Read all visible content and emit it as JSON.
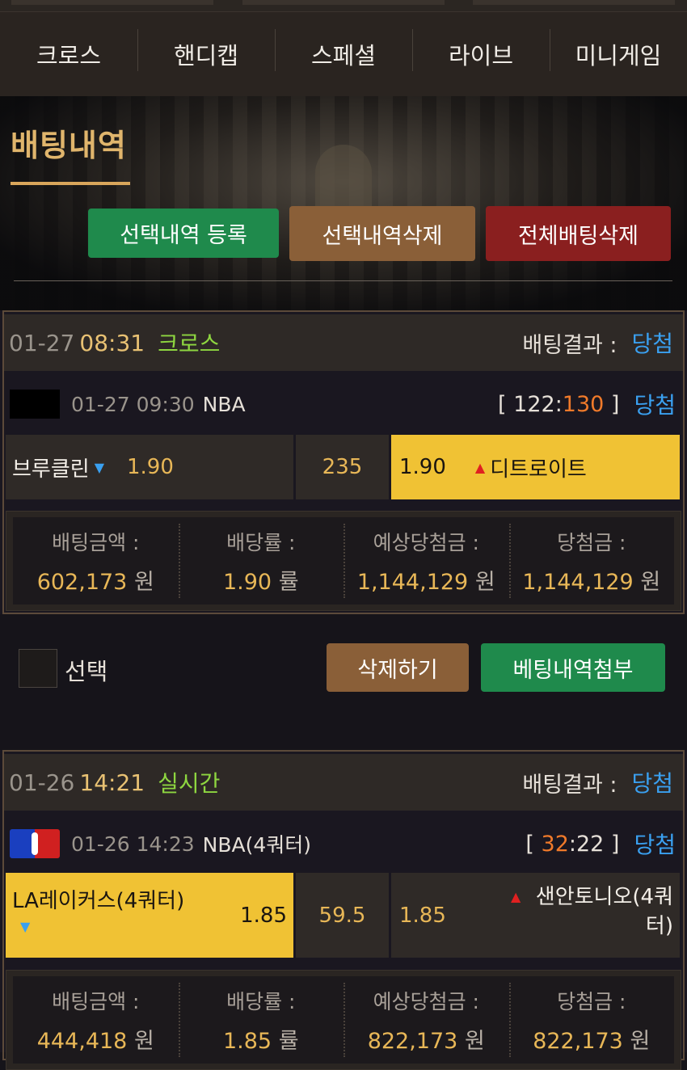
{
  "nav": {
    "items": [
      "크로스",
      "핸디캡",
      "스페셜",
      "라이브",
      "미니게임"
    ]
  },
  "hero": {
    "title": "배팅내역",
    "buttons": {
      "register": "선택내역 등록",
      "delete_selected": "선택내역삭제",
      "delete_all": "전체배팅삭제"
    }
  },
  "bets": [
    {
      "date": "01-27",
      "time": "08:31",
      "type": "크로스",
      "result_label": "배팅결과 :",
      "result": "당첨",
      "match": {
        "date": "01-27 09:30",
        "league": "NBA",
        "score_left": "122",
        "score_right": "130",
        "result": "당첨",
        "home": "브루클린",
        "home_odd": "1.90",
        "line": "235",
        "away_odd": "1.90",
        "away": "디트로이트",
        "selected": "away"
      },
      "summary": {
        "bet_amount_label": "배팅금액 :",
        "bet_amount": "602,173",
        "odds_label": "배당률 :",
        "odds": "1.90",
        "expected_label": "예상당첨금 :",
        "expected": "1,144,129",
        "win_label": "당첨금 :",
        "win": "1,144,129",
        "won_unit": "원",
        "rate_unit": "률"
      }
    },
    {
      "date": "01-26",
      "time": "14:21",
      "type": "실시간",
      "result_label": "배팅결과 :",
      "result": "당첨",
      "match": {
        "date": "01-26 14:23",
        "league": "NBA(4쿼터)",
        "score_left": "32",
        "score_right": "22",
        "result": "당첨",
        "home": "LA레이커스(4쿼터)",
        "home_odd": "1.85",
        "line": "59.5",
        "away_odd": "1.85",
        "away": "샌안토니오(4쿼터)",
        "selected": "home"
      },
      "summary": {
        "bet_amount_label": "배팅금액 :",
        "bet_amount": "444,418",
        "odds_label": "배당률 :",
        "odds": "1.85",
        "expected_label": "예상당첨금 :",
        "expected": "822,173",
        "win_label": "당첨금 :",
        "win": "822,173",
        "won_unit": "원",
        "rate_unit": "률"
      }
    }
  ],
  "actions": {
    "select_label": "선택",
    "delete": "삭제하기",
    "attach": "베팅내역첨부"
  },
  "colors": {
    "accent_gold": "#e0b56c",
    "win_blue": "#3aa0f0",
    "selected_yellow": "#f0c234",
    "type_green": "#8ed640"
  }
}
